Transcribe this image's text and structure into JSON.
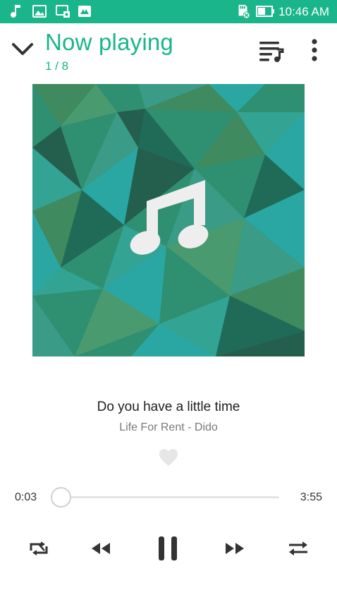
{
  "status_bar": {
    "time": "10:46 AM",
    "left_icons": [
      "music-note-icon",
      "image-icon",
      "cast-icon",
      "gallery-icon"
    ],
    "right_icons": [
      "sd-card-error-icon",
      "battery-icon"
    ],
    "bg_color": "#1ab58a"
  },
  "header": {
    "title": "Now playing",
    "counter": "1 / 8",
    "accent_color": "#1ab58a",
    "icons": [
      "chevron-down-icon",
      "queue-music-icon",
      "more-vert-icon"
    ]
  },
  "album_art": {
    "icon": "music-note-icon",
    "palette": [
      "#2f8f71",
      "#1f6b58",
      "#3a9b86",
      "#2aa7a3",
      "#3f8a5e",
      "#245f4e",
      "#33a394",
      "#4a9a70"
    ]
  },
  "track": {
    "title": "Do you have a little time",
    "subtitle": "Life For Rent - Dido",
    "favorite_icon": "heart-icon"
  },
  "progress": {
    "current": "0:03",
    "total": "3:55",
    "fraction": 0.013
  },
  "controls": {
    "icons": [
      "repeat-icon",
      "rewind-icon",
      "pause-icon",
      "fast-forward-icon",
      "shuffle-icon"
    ]
  }
}
